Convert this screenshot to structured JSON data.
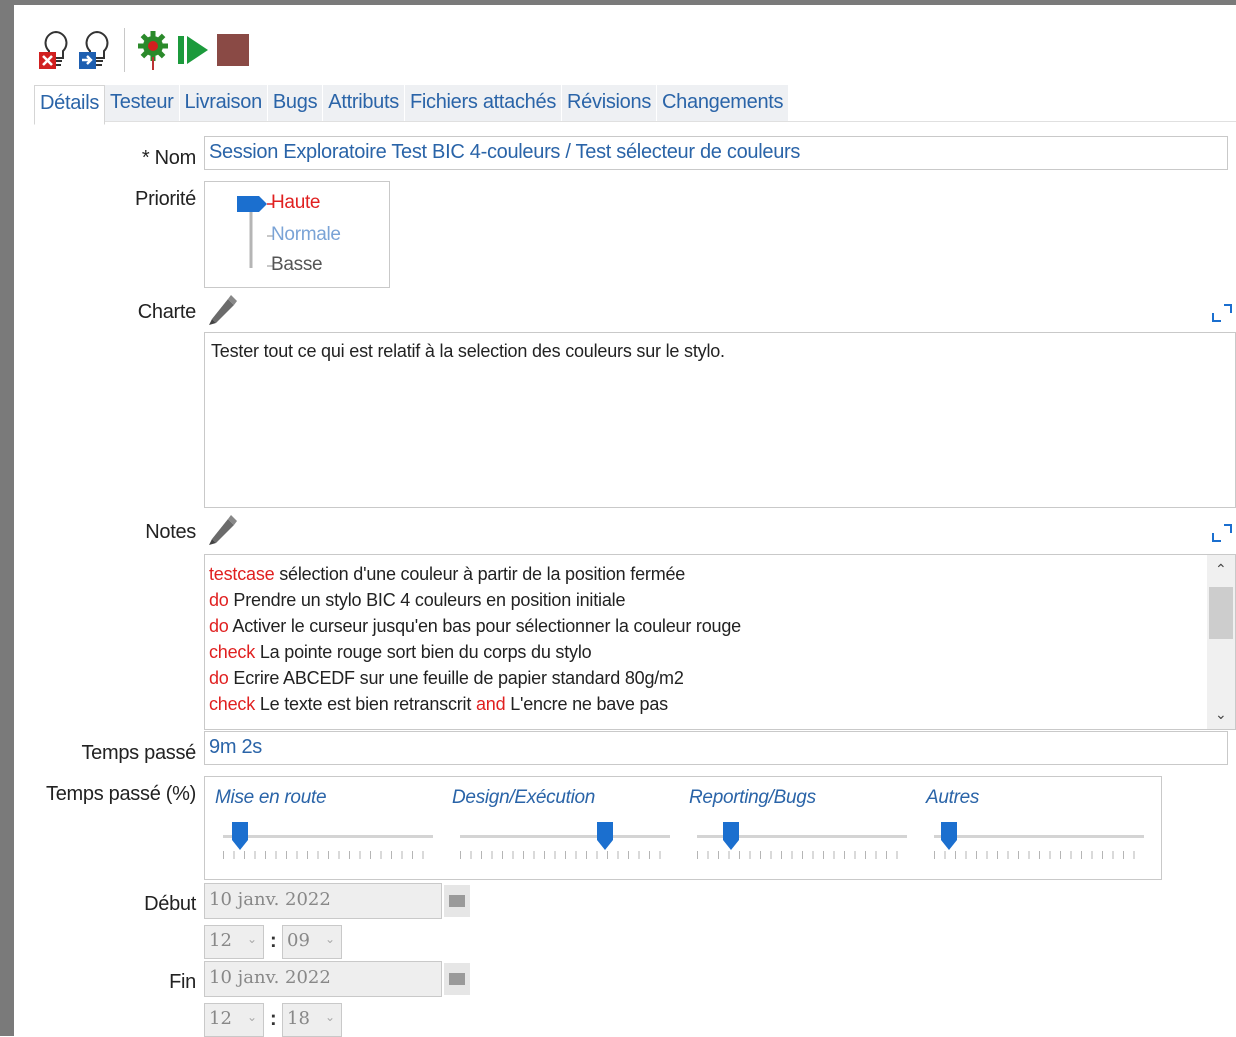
{
  "toolbar": {
    "icons": [
      "bulb-delete-icon",
      "bulb-save-icon",
      "gear-icon",
      "play-icon",
      "stop-icon"
    ]
  },
  "tabs": [
    {
      "label": "Détails",
      "active": true
    },
    {
      "label": "Testeur"
    },
    {
      "label": "Livraison"
    },
    {
      "label": "Bugs"
    },
    {
      "label": "Attributs"
    },
    {
      "label": "Fichiers attachés"
    },
    {
      "label": "Révisions"
    },
    {
      "label": "Changements"
    }
  ],
  "form": {
    "nom_label": "* Nom",
    "nom_value": "Session Exploratoire Test BIC 4-couleurs / Test sélecteur de couleurs",
    "priorite_label": "Priorité",
    "priorite": {
      "options": [
        "Haute",
        "Normale",
        "Basse"
      ],
      "selected": "Haute"
    },
    "charte_label": "Charte",
    "charte_text": "Tester tout ce qui est relatif à la selection des couleurs sur le stylo.",
    "notes_label": "Notes",
    "notes_lines": [
      {
        "kw": "testcase",
        "text": " sélection d'une couleur à partir de la position fermée"
      },
      {
        "kw": "do",
        "text": " Prendre un stylo BIC 4 couleurs en position initiale"
      },
      {
        "kw": "do",
        "text": " Activer le curseur jusqu'en bas pour sélectionner la couleur rouge"
      },
      {
        "kw": "check",
        "text": " La pointe rouge sort bien du corps du stylo"
      },
      {
        "kw": "do",
        "text": " Ecrire ABCEDF sur une feuille de papier standard 80g/m2"
      },
      {
        "kw": "check",
        "text": " Le texte est bien retranscrit ",
        "kw2": "and",
        "text2": " L'encre ne bave pas"
      }
    ],
    "temps_label": "Temps passé",
    "temps_value": "9m 2s",
    "temps_pct_label": "Temps passé (%)",
    "temps_pct": [
      {
        "label": "Mise en route",
        "value": 0.08
      },
      {
        "label": "Design/Exécution",
        "value": 0.69
      },
      {
        "label": "Reporting/Bugs",
        "value": 0.16
      },
      {
        "label": "Autres",
        "value": 0.07
      }
    ],
    "debut_label": "Début",
    "debut_date": "10 janv. 2022",
    "debut_hour": "12",
    "debut_min": "09",
    "fin_label": "Fin",
    "fin_date": "10 janv. 2022",
    "fin_hour": "12",
    "fin_min": "18",
    "colon": ":"
  },
  "colors": {
    "accent": "#2a64a8",
    "keyword": "#e02020",
    "slider": "#1b6fcf"
  }
}
